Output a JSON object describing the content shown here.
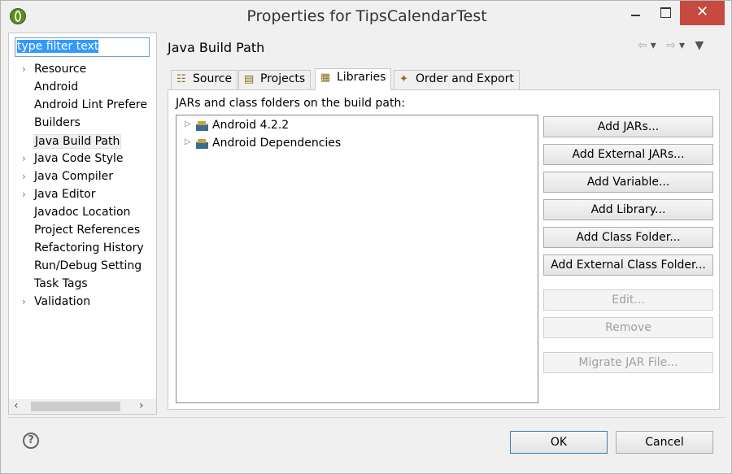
{
  "window": {
    "title": "Properties for TipsCalendarTest",
    "close_glyph": "✕"
  },
  "filter": {
    "value": "type filter text"
  },
  "nav": [
    {
      "label": "Resource",
      "expandable": true
    },
    {
      "label": "Android",
      "expandable": false
    },
    {
      "label": "Android Lint Prefere",
      "expandable": false
    },
    {
      "label": "Builders",
      "expandable": false
    },
    {
      "label": "Java Build Path",
      "expandable": false,
      "selected": true
    },
    {
      "label": "Java Code Style",
      "expandable": true
    },
    {
      "label": "Java Compiler",
      "expandable": true
    },
    {
      "label": "Java Editor",
      "expandable": true
    },
    {
      "label": "Javadoc Location",
      "expandable": false
    },
    {
      "label": "Project References",
      "expandable": false
    },
    {
      "label": "Refactoring History",
      "expandable": false
    },
    {
      "label": "Run/Debug Setting",
      "expandable": false
    },
    {
      "label": "Task Tags",
      "expandable": false
    },
    {
      "label": "Validation",
      "expandable": true
    }
  ],
  "page": {
    "title": "Java Build Path"
  },
  "tabs": [
    {
      "label": "Source",
      "icon": "source-folder-icon"
    },
    {
      "label": "Projects",
      "icon": "projects-icon"
    },
    {
      "label": "Libraries",
      "icon": "library-icon",
      "active": true
    },
    {
      "label": "Order and Export",
      "icon": "order-export-icon"
    }
  ],
  "libraries": {
    "section_label": "JARs and class folders on the build path:",
    "entries": [
      "Android 4.2.2",
      "Android Dependencies"
    ]
  },
  "buttons": {
    "add_jars": "Add JARs...",
    "add_external_jars": "Add External JARs...",
    "add_variable": "Add Variable...",
    "add_library": "Add Library...",
    "add_class_folder": "Add Class Folder...",
    "add_external_class_folder": "Add External Class Folder...",
    "edit": "Edit...",
    "remove": "Remove",
    "migrate_jar": "Migrate JAR File..."
  },
  "footer": {
    "help_glyph": "?",
    "ok": "OK",
    "cancel": "Cancel"
  }
}
